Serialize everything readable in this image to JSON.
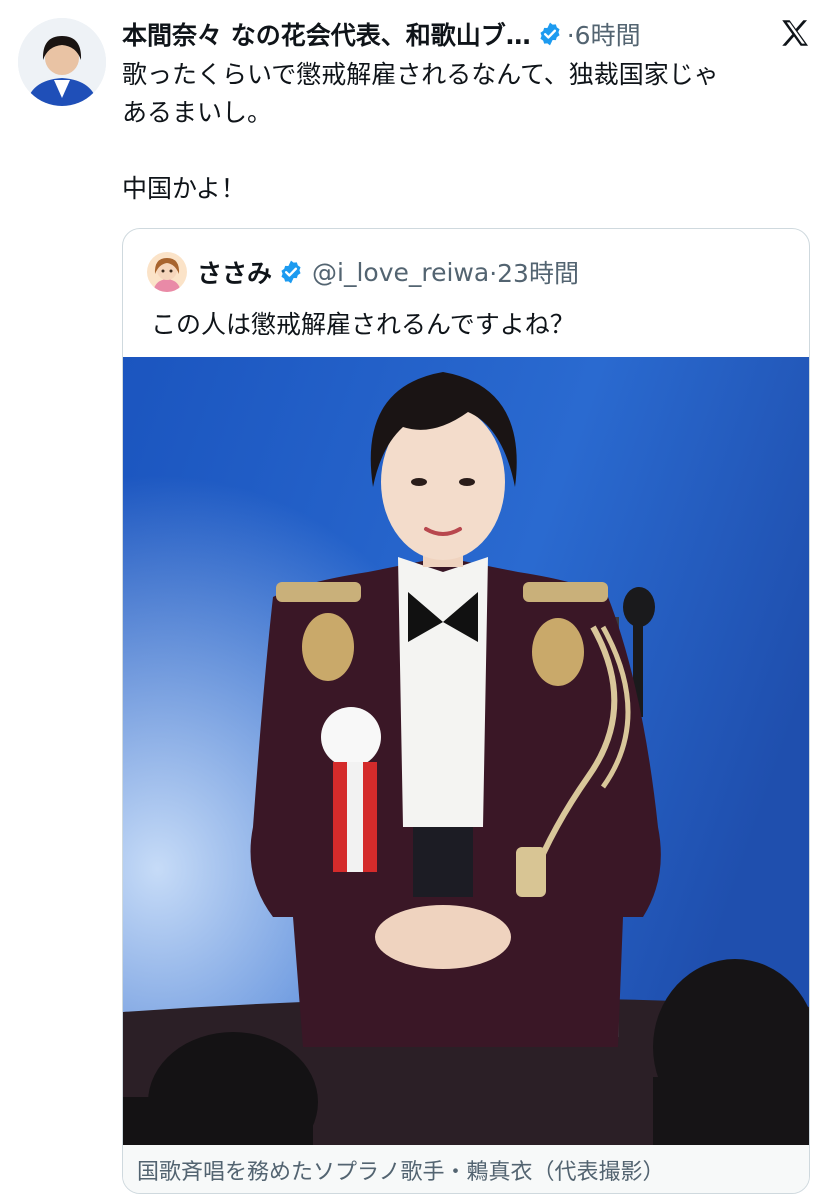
{
  "tweet": {
    "author_name": "本間奈々 なの花会代表、和歌山ブ…",
    "time": "·6時間",
    "text": "歌ったくらいで懲戒解雇されるなんて、独裁国家じゃ\nあるまいし。\n\n中国かよ！"
  },
  "quote": {
    "author_name": "ささみ",
    "handle": "@i_love_reiwa",
    "time": "·23時間",
    "text": "この人は懲戒解雇されるんですよね？",
    "photo_caption": "国歌斉唱を務めたソプラノ歌手・鶫真衣（代表撮影）"
  },
  "icons": {
    "verified": "verified-badge-icon",
    "brand": "x-logo-icon"
  },
  "colors": {
    "verified_blue": "#1d9bf0",
    "secondary_text": "#536471",
    "border": "#cfd9de",
    "photo_background": "#1f5fc4"
  }
}
